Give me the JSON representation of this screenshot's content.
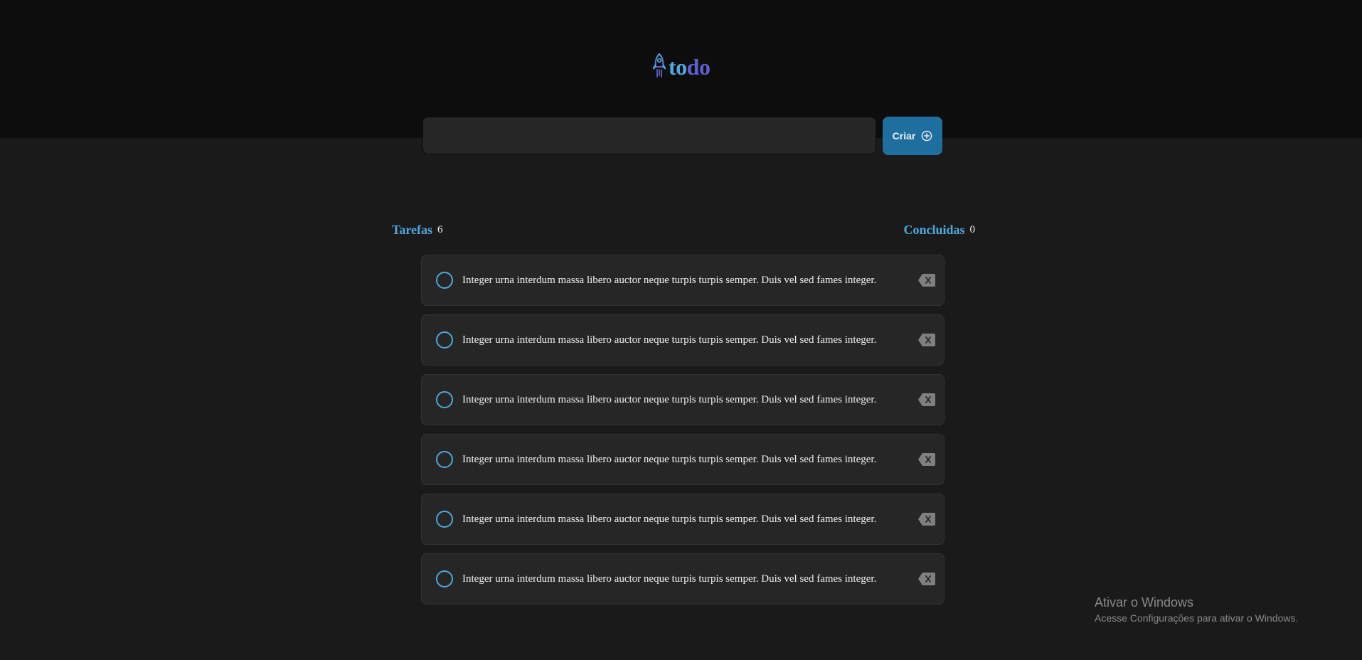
{
  "header": {
    "logo": {
      "part1": "to",
      "part2": "do"
    },
    "input": {
      "value": "",
      "placeholder": ""
    },
    "create_button": {
      "label": "Criar",
      "icon": "plus-circle-icon"
    }
  },
  "counters": {
    "created": {
      "label": "Tarefas",
      "count": "6"
    },
    "done": {
      "label": "Concluidas",
      "count": "0"
    }
  },
  "tasks": [
    {
      "text": "Integer urna interdum massa libero auctor neque turpis turpis semper. Duis vel sed fames integer.",
      "done": false
    },
    {
      "text": "Integer urna interdum massa libero auctor neque turpis turpis semper. Duis vel sed fames integer.",
      "done": false
    },
    {
      "text": "Integer urna interdum massa libero auctor neque turpis turpis semper. Duis vel sed fames integer.",
      "done": false
    },
    {
      "text": "Integer urna interdum massa libero auctor neque turpis turpis semper. Duis vel sed fames integer.",
      "done": false
    },
    {
      "text": "Integer urna interdum massa libero auctor neque turpis turpis semper. Duis vel sed fames integer.",
      "done": false
    },
    {
      "text": "Integer urna interdum massa libero auctor neque turpis turpis semper. Duis vel sed fames integer.",
      "done": false
    }
  ],
  "windows_watermark": {
    "title": "Ativar o Windows",
    "subtitle": "Acesse Configurações para ativar o Windows."
  },
  "colors": {
    "blue": "#4ea8de",
    "purple": "#5e60ce",
    "button": "#1e6f9f",
    "header_bg": "#0d0d0d",
    "page_bg": "#1a1a1a",
    "card_bg": "#262626"
  }
}
